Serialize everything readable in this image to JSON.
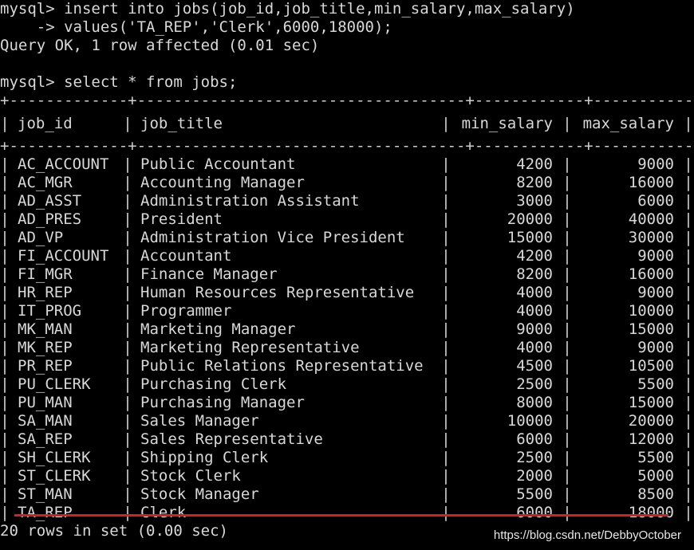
{
  "terminal": {
    "cmd1_line1": "mysql> insert into jobs(job_id,job_title,min_salary,max_salary)",
    "cmd1_line2": "    -> values('TA_REP','Clerk',6000,18000);",
    "cmd1_result": "Query OK, 1 row affected (0.01 sec)",
    "cmd2": "mysql> select * from jobs;",
    "footer": "20 rows in set (0.00 sec)"
  },
  "table": {
    "border_top": "+-------------+------------------------------------+------------+------------+",
    "columns": [
      "job_id",
      "job_title",
      "min_salary",
      "max_salary"
    ],
    "rows": [
      [
        "AC_ACCOUNT",
        "Public Accountant",
        "4200",
        "9000"
      ],
      [
        "AC_MGR",
        "Accounting Manager",
        "8200",
        "16000"
      ],
      [
        "AD_ASST",
        "Administration Assistant",
        "3000",
        "6000"
      ],
      [
        "AD_PRES",
        "President",
        "20000",
        "40000"
      ],
      [
        "AD_VP",
        "Administration Vice President",
        "15000",
        "30000"
      ],
      [
        "FI_ACCOUNT",
        "Accountant",
        "4200",
        "9000"
      ],
      [
        "FI_MGR",
        "Finance Manager",
        "8200",
        "16000"
      ],
      [
        "HR_REP",
        "Human Resources Representative",
        "4000",
        "9000"
      ],
      [
        "IT_PROG",
        "Programmer",
        "4000",
        "10000"
      ],
      [
        "MK_MAN",
        "Marketing Manager",
        "9000",
        "15000"
      ],
      [
        "MK_REP",
        "Marketing Representative",
        "4000",
        "9000"
      ],
      [
        "PR_REP",
        "Public Relations Representative",
        "4500",
        "10500"
      ],
      [
        "PU_CLERK",
        "Purchasing Clerk",
        "2500",
        "5500"
      ],
      [
        "PU_MAN",
        "Purchasing Manager",
        "8000",
        "15000"
      ],
      [
        "SA_MAN",
        "Sales Manager",
        "10000",
        "20000"
      ],
      [
        "SA_REP",
        "Sales Representative",
        "6000",
        "12000"
      ],
      [
        "SH_CLERK",
        "Shipping Clerk",
        "2500",
        "5500"
      ],
      [
        "ST_CLERK",
        "Stock Clerk",
        "2000",
        "5000"
      ],
      [
        "ST_MAN",
        "Stock Manager",
        "5500",
        "8500"
      ],
      [
        "TA_REP",
        "Clerk",
        "6000",
        "18000"
      ]
    ]
  },
  "watermark": "https://blog.csdn.net/DebbyOctober",
  "colors": {
    "background": "#000000",
    "text": "#d8d8d8",
    "highlight": "#d62020"
  }
}
